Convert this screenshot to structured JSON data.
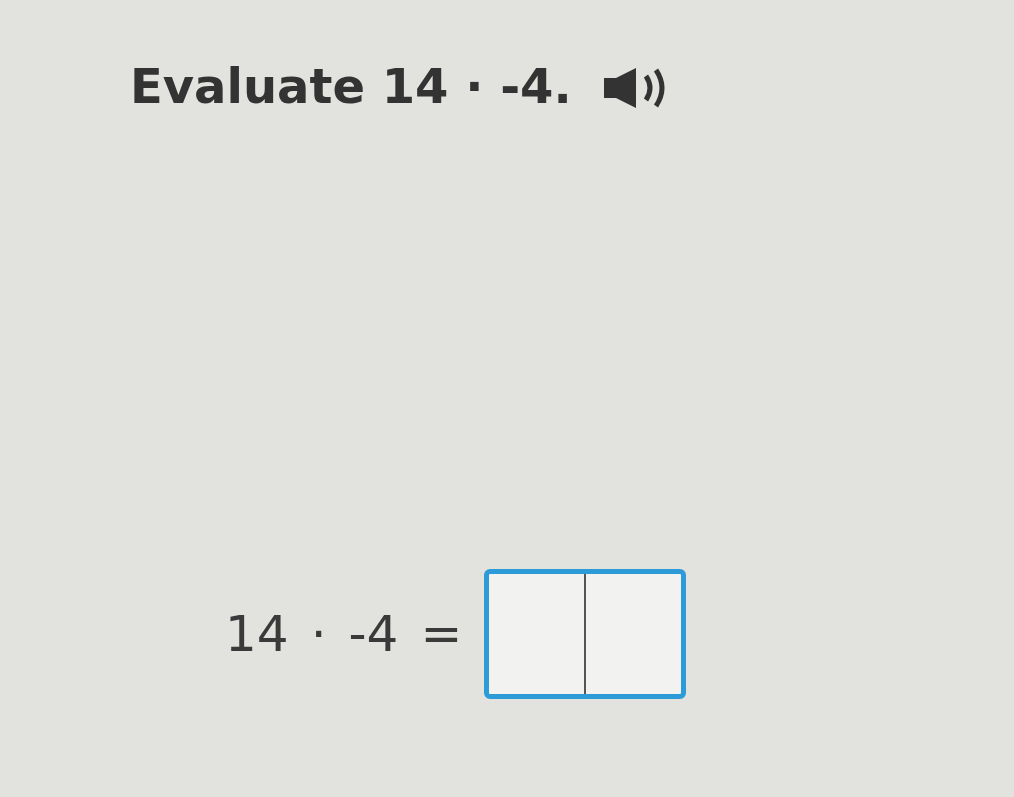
{
  "question": {
    "prompt": "Evaluate 14 · -4."
  },
  "equation": {
    "terms": [
      "14",
      "·",
      "-4",
      "="
    ]
  }
}
